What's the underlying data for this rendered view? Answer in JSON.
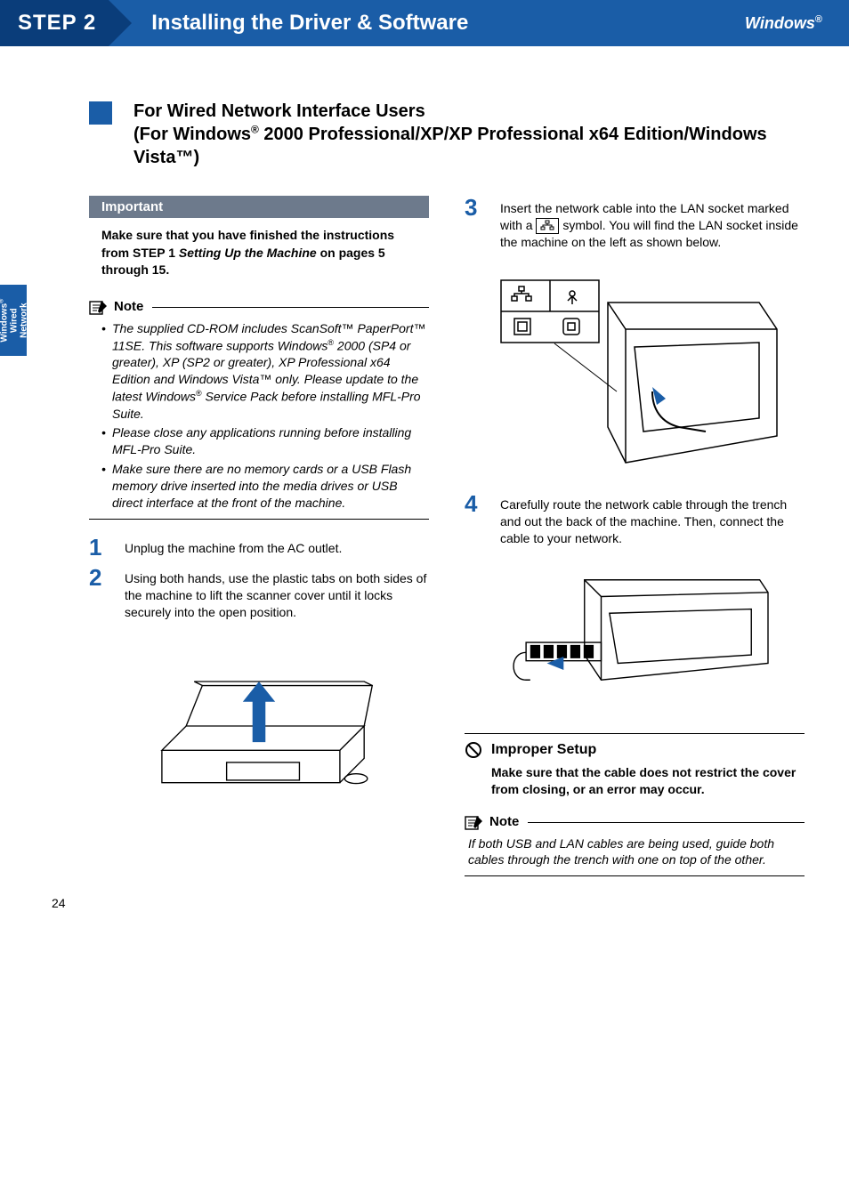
{
  "header": {
    "step_label": "STEP 2",
    "title": "Installing the Driver & Software",
    "os": "Windows",
    "os_sup": "®"
  },
  "side_tab": {
    "line1_a": "Windows",
    "line1_sup": "®",
    "line2": "Wired",
    "line3": "Network"
  },
  "section": {
    "line1": "For Wired Network Interface Users",
    "line2_a": "(For Windows",
    "line2_sup": "®",
    "line2_b": " 2000 Professional/XP/XP Professional x64 Edition/Windows Vista™)"
  },
  "important": {
    "label": "Important",
    "body_a": "Make sure that you have finished the instructions from STEP 1 ",
    "body_i": "Setting Up the Machine",
    "body_b": " on pages 5 through 15."
  },
  "note1": {
    "label": "Note",
    "b1_a": "The supplied CD-ROM includes ScanSoft™ PaperPort™ 11SE. This software supports Windows",
    "b1_sup1": "®",
    "b1_b": " 2000 (SP4 or greater), XP (SP2 or greater), XP Professional x64 Edition and Windows Vista™ only. Please update to the latest Windows",
    "b1_sup2": "®",
    "b1_c": " Service Pack before installing MFL-Pro Suite.",
    "b2": "Please close any applications running before installing MFL-Pro Suite.",
    "b3": "Make sure there are no memory cards or a USB Flash memory drive inserted into the media drives or USB direct interface at the front of the machine."
  },
  "steps": {
    "s1": {
      "num": "1",
      "text": "Unplug the machine from the AC outlet."
    },
    "s2": {
      "num": "2",
      "text": "Using both hands, use the plastic tabs on both sides of the machine to lift the scanner cover until it locks securely into the open position."
    },
    "s3": {
      "num": "3",
      "text_a": "Insert the network cable into the LAN socket marked with a ",
      "text_b": " symbol. You will find the LAN socket inside the machine on the left as shown below."
    },
    "s4": {
      "num": "4",
      "text": "Carefully route the network cable through the trench and out the back of the machine. Then, connect the cable to your network."
    }
  },
  "improper": {
    "label": "Improper Setup",
    "body": "Make sure that the cable does not restrict the cover from closing, or an error may occur."
  },
  "note2": {
    "label": "Note",
    "body": "If both USB and LAN cables are being used, guide both cables through the trench with one on top of the other."
  },
  "page_number": "24"
}
